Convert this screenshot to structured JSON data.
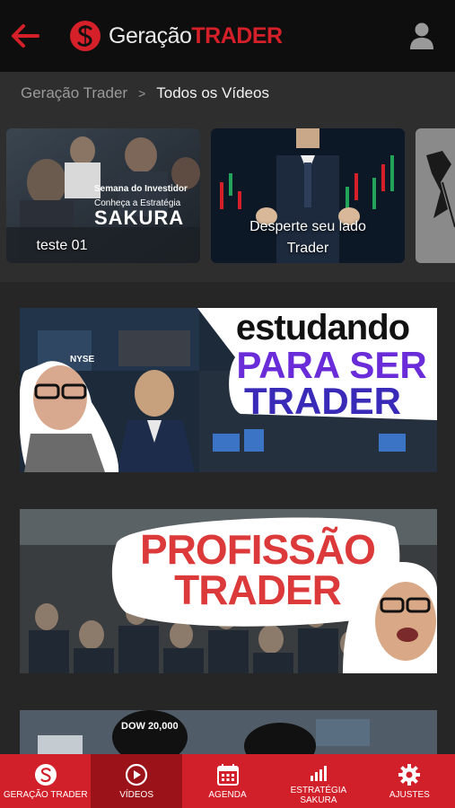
{
  "header": {
    "logo_word1": "Geração",
    "logo_word2": "TRADER"
  },
  "breadcrumb": {
    "parent": "Geração Trader",
    "separator": ">",
    "current": "Todos os Vídeos"
  },
  "carousel": [
    {
      "label": "teste 01",
      "overlay_lines": [
        "Semana do Investidor",
        "Conheça a Estratégia",
        "SAKURA"
      ]
    },
    {
      "label_line1": "Desperte seu lado",
      "label_line2": "Trader"
    }
  ],
  "videos": [
    {
      "title_line1": "estudando",
      "title_line2": "PARA SER",
      "title_line3": "TRADER",
      "ticker": "NYSE"
    },
    {
      "title_line1": "PROFISSÃO",
      "title_line2": "TRADER"
    },
    {
      "caption": "DOW 20,000"
    }
  ],
  "bottom_nav": [
    {
      "label": "GERAÇÃO TRADER",
      "icon": "logo-icon",
      "active": false
    },
    {
      "label": "VÍDEOS",
      "icon": "play-icon",
      "active": true
    },
    {
      "label": "AGENDA",
      "icon": "calendar-icon",
      "active": false
    },
    {
      "label_line1": "ESTRATÉGIA",
      "label_line2": "SAKURA",
      "icon": "chart-icon",
      "active": false
    },
    {
      "label": "AJUSTES",
      "icon": "gear-icon",
      "active": false
    }
  ],
  "colors": {
    "brand_red": "#d5202a",
    "nav_active": "#9c1219",
    "header_bg": "#0e0e0e",
    "page_bg": "#262626"
  }
}
